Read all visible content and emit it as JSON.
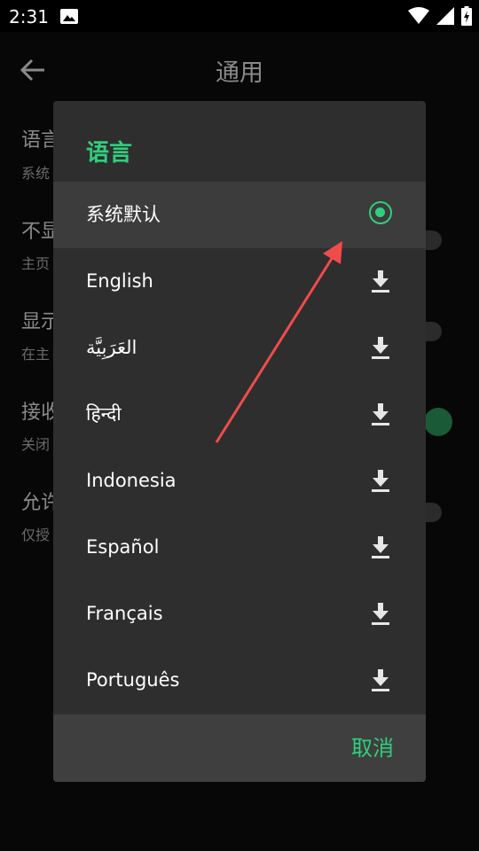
{
  "status_bar": {
    "time": "2:31"
  },
  "background_page": {
    "title": "通用",
    "items": [
      {
        "title": "语言",
        "subtitle": "系统"
      },
      {
        "title": "不显",
        "subtitle": "主页"
      },
      {
        "title": "显示",
        "subtitle": "在主"
      },
      {
        "title": "接收",
        "subtitle": "关闭"
      },
      {
        "title": "允许",
        "subtitle": "仅授"
      }
    ]
  },
  "dialog": {
    "title": "语言",
    "options": [
      {
        "label": "系统默认",
        "selected": true
      },
      {
        "label": "English"
      },
      {
        "label": "العَرَبِيَّة"
      },
      {
        "label": "हिन्दी"
      },
      {
        "label": "Indonesia"
      },
      {
        "label": "Español"
      },
      {
        "label": "Français"
      },
      {
        "label": "Português"
      }
    ],
    "cancel_label": "取消"
  },
  "colors": {
    "accent": "#2fcf7e",
    "annotation_arrow": "#f04c4c"
  },
  "icons": {
    "back": "arrow-back-icon",
    "download": "download-icon",
    "radio": "radio-selected-icon"
  }
}
